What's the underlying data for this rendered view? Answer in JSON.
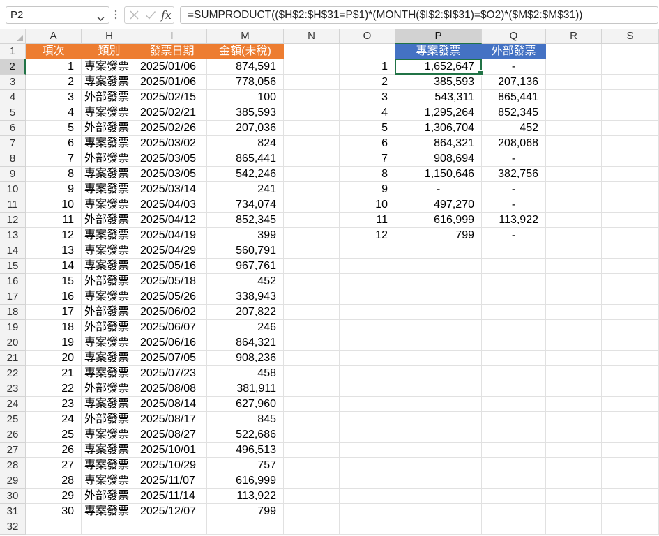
{
  "formula_bar": {
    "name_box": "P2",
    "cancel_icon": "close-icon",
    "enter_icon": "check-icon",
    "fx_label": "fx",
    "formula": "=SUMPRODUCT(($H$2:$H$31=P$1)*(MONTH($I$2:$I$31)=$O2)*($M$2:$M$31))"
  },
  "columns": [
    "A",
    "H",
    "I",
    "M",
    "N",
    "O",
    "P",
    "Q",
    "R",
    "S"
  ],
  "selected": {
    "cell": "P2",
    "column": "P",
    "row": 2
  },
  "rows": [
    1,
    2,
    3,
    4,
    5,
    6,
    7,
    8,
    9,
    10,
    11,
    12,
    13,
    14,
    15,
    16,
    17,
    18,
    19,
    20,
    21,
    22,
    23,
    24,
    25,
    26,
    27,
    28,
    29,
    30,
    31,
    32
  ],
  "table": {
    "headers": [
      "項次",
      "類別",
      "發票日期",
      "金額(未稅)"
    ],
    "rows": [
      [
        "1",
        "專案發票",
        "2025/01/06",
        "874,591"
      ],
      [
        "2",
        "專案發票",
        "2025/01/06",
        "778,056"
      ],
      [
        "3",
        "外部發票",
        "2025/02/15",
        "100"
      ],
      [
        "4",
        "專案發票",
        "2025/02/21",
        "385,593"
      ],
      [
        "5",
        "外部發票",
        "2025/02/26",
        "207,036"
      ],
      [
        "6",
        "專案發票",
        "2025/03/02",
        "824"
      ],
      [
        "7",
        "外部發票",
        "2025/03/05",
        "865,441"
      ],
      [
        "8",
        "專案發票",
        "2025/03/05",
        "542,246"
      ],
      [
        "9",
        "專案發票",
        "2025/03/14",
        "241"
      ],
      [
        "10",
        "專案發票",
        "2025/04/03",
        "734,074"
      ],
      [
        "11",
        "外部發票",
        "2025/04/12",
        "852,345"
      ],
      [
        "12",
        "專案發票",
        "2025/04/19",
        "399"
      ],
      [
        "13",
        "專案發票",
        "2025/04/29",
        "560,791"
      ],
      [
        "14",
        "專案發票",
        "2025/05/16",
        "967,761"
      ],
      [
        "15",
        "外部發票",
        "2025/05/18",
        "452"
      ],
      [
        "16",
        "專案發票",
        "2025/05/26",
        "338,943"
      ],
      [
        "17",
        "外部發票",
        "2025/06/02",
        "207,822"
      ],
      [
        "18",
        "外部發票",
        "2025/06/07",
        "246"
      ],
      [
        "19",
        "專案發票",
        "2025/06/16",
        "864,321"
      ],
      [
        "20",
        "專案發票",
        "2025/07/05",
        "908,236"
      ],
      [
        "21",
        "專案發票",
        "2025/07/23",
        "458"
      ],
      [
        "22",
        "外部發票",
        "2025/08/08",
        "381,911"
      ],
      [
        "23",
        "專案發票",
        "2025/08/14",
        "627,960"
      ],
      [
        "24",
        "外部發票",
        "2025/08/17",
        "845"
      ],
      [
        "25",
        "專案發票",
        "2025/08/27",
        "522,686"
      ],
      [
        "26",
        "專案發票",
        "2025/10/01",
        "496,513"
      ],
      [
        "27",
        "專案發票",
        "2025/10/29",
        "757"
      ],
      [
        "28",
        "專案發票",
        "2025/11/07",
        "616,999"
      ],
      [
        "29",
        "外部發票",
        "2025/11/14",
        "113,922"
      ],
      [
        "30",
        "專案發票",
        "2025/12/07",
        "799"
      ]
    ]
  },
  "summary": {
    "headers": [
      "專案發票",
      "外部發票"
    ],
    "rows": [
      [
        "1",
        "1,652,647",
        "-"
      ],
      [
        "2",
        "385,593",
        "207,136"
      ],
      [
        "3",
        "543,311",
        "865,441"
      ],
      [
        "4",
        "1,295,264",
        "852,345"
      ],
      [
        "5",
        "1,306,704",
        "452"
      ],
      [
        "6",
        "864,321",
        "208,068"
      ],
      [
        "7",
        "908,694",
        "-"
      ],
      [
        "8",
        "1,150,646",
        "382,756"
      ],
      [
        "9",
        "-",
        "-"
      ],
      [
        "10",
        "497,270",
        "-"
      ],
      [
        "11",
        "616,999",
        "113,922"
      ],
      [
        "12",
        "799",
        "-"
      ]
    ]
  },
  "colors": {
    "header_orange": "#ed7d31",
    "header_blue": "#4472c4",
    "selection_green": "#217346"
  }
}
